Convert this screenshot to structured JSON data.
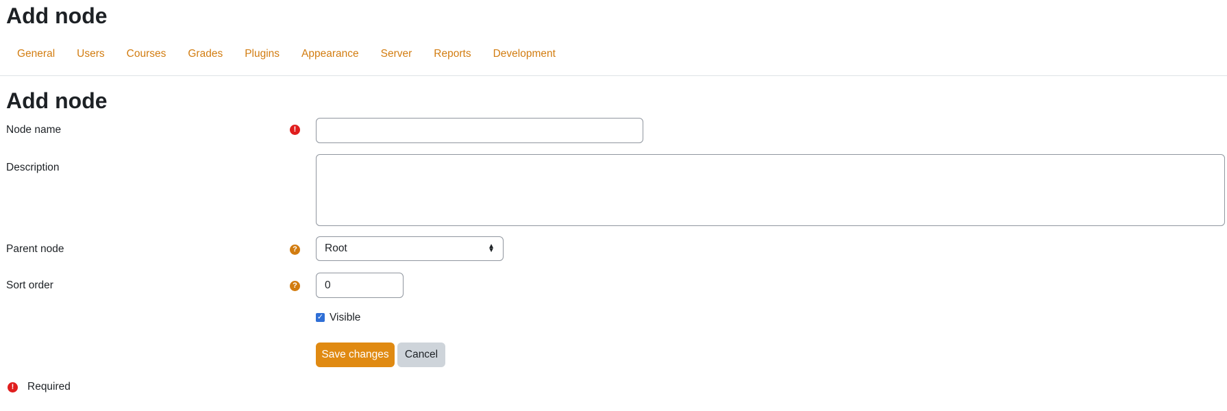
{
  "page": {
    "title": "Add node",
    "section_title": "Add node"
  },
  "nav": {
    "items": [
      "General",
      "Users",
      "Courses",
      "Grades",
      "Plugins",
      "Appearance",
      "Server",
      "Reports",
      "Development"
    ]
  },
  "form": {
    "node_name": {
      "label": "Node name",
      "value": "",
      "required_icon": "!"
    },
    "description": {
      "label": "Description",
      "value": ""
    },
    "parent_node": {
      "label": "Parent node",
      "selected": "Root",
      "help_icon": "?"
    },
    "sort_order": {
      "label": "Sort order",
      "value": "0",
      "help_icon": "?"
    },
    "visible": {
      "label": "Visible",
      "checked": true
    },
    "save_label": "Save changes",
    "cancel_label": "Cancel",
    "required_note": "Required"
  },
  "colors": {
    "accent": "#d27c10",
    "primary_button": "#e08a12",
    "secondary_button": "#ced4da",
    "required": "#e01e1e",
    "checkbox": "#2f6fd6"
  }
}
